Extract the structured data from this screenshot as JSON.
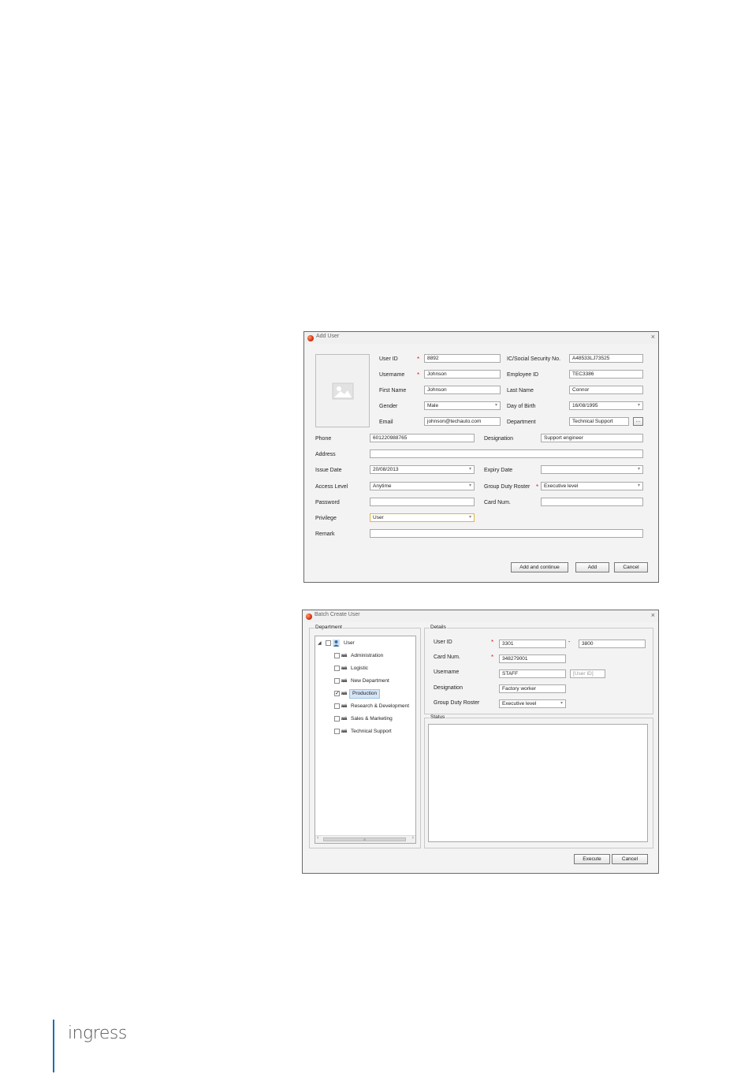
{
  "add_user": {
    "title": "Add User",
    "close": "×",
    "fields": {
      "user_id": {
        "label": "User ID",
        "value": "8892"
      },
      "username": {
        "label": "Username",
        "value": "Johnson"
      },
      "first_name": {
        "label": "First Name",
        "value": "Johnson"
      },
      "gender": {
        "label": "Gender",
        "value": "Male"
      },
      "email": {
        "label": "Email",
        "value": "johnson@techauto.com"
      },
      "ic": {
        "label": "IC/Social Security No.",
        "value": "A48533LJ73525"
      },
      "employee_id": {
        "label": "Employee ID",
        "value": "TEC3386"
      },
      "last_name": {
        "label": "Last Name",
        "value": "Connor"
      },
      "dob": {
        "label": "Day of Birth",
        "value": "16/08/1995"
      },
      "department": {
        "label": "Department",
        "value": "Technical Support",
        "browse": "..."
      },
      "phone": {
        "label": "Phone",
        "value": "601220988765"
      },
      "designation": {
        "label": "Designation",
        "value": "Support engineer"
      },
      "address": {
        "label": "Address",
        "value": ""
      },
      "issue_date": {
        "label": "Issue Date",
        "value": "20/08/2013"
      },
      "expiry_date": {
        "label": "Expiry Date",
        "value": ""
      },
      "access_level": {
        "label": "Access Level",
        "value": "Anytime"
      },
      "group_duty_roster": {
        "label": "Group Duty Roster",
        "value": "Executive level"
      },
      "password": {
        "label": "Password",
        "value": ""
      },
      "card_num": {
        "label": "Card Num.",
        "value": ""
      },
      "privilege": {
        "label": "Privilege",
        "value": "User"
      },
      "remark": {
        "label": "Remark",
        "value": ""
      }
    },
    "required_mark": "*",
    "buttons": {
      "add_continue": "Add and continue",
      "add": "Add",
      "cancel": "Cancel"
    }
  },
  "batch": {
    "title": "Batch Create User",
    "close": "×",
    "department_group": "Department",
    "details_group": "Details",
    "status_group": "Status",
    "tree": {
      "root": "User",
      "items": [
        {
          "label": "Administration",
          "checked": false
        },
        {
          "label": "Logistic",
          "checked": false
        },
        {
          "label": "New Department",
          "checked": false
        },
        {
          "label": "Production",
          "checked": true
        },
        {
          "label": "Research & Development",
          "checked": false
        },
        {
          "label": "Sales & Marketing",
          "checked": false
        },
        {
          "label": "Technical Support",
          "checked": false
        }
      ],
      "dept_icon_text": "ääå",
      "scroll_left": "‹",
      "scroll_right": "›",
      "scroll_grip": "III"
    },
    "details": {
      "user_id": {
        "label": "User ID",
        "from": "3301",
        "sep": "-",
        "to": "3800"
      },
      "card_num": {
        "label": "Card Num.",
        "value": "348279001"
      },
      "username": {
        "label": "Username",
        "value": "STAFF",
        "suffix_placeholder": "[User ID]"
      },
      "designation": {
        "label": "Designation",
        "value": "Factory worker"
      },
      "group_duty_roster": {
        "label": "Group Duty Roster",
        "value": "Executive level"
      }
    },
    "required_mark": "*",
    "buttons": {
      "execute": "Execute",
      "cancel": "Cancel"
    }
  },
  "footer": {
    "logo_text": "ingress",
    "accent_color": "#1a6fb5"
  }
}
